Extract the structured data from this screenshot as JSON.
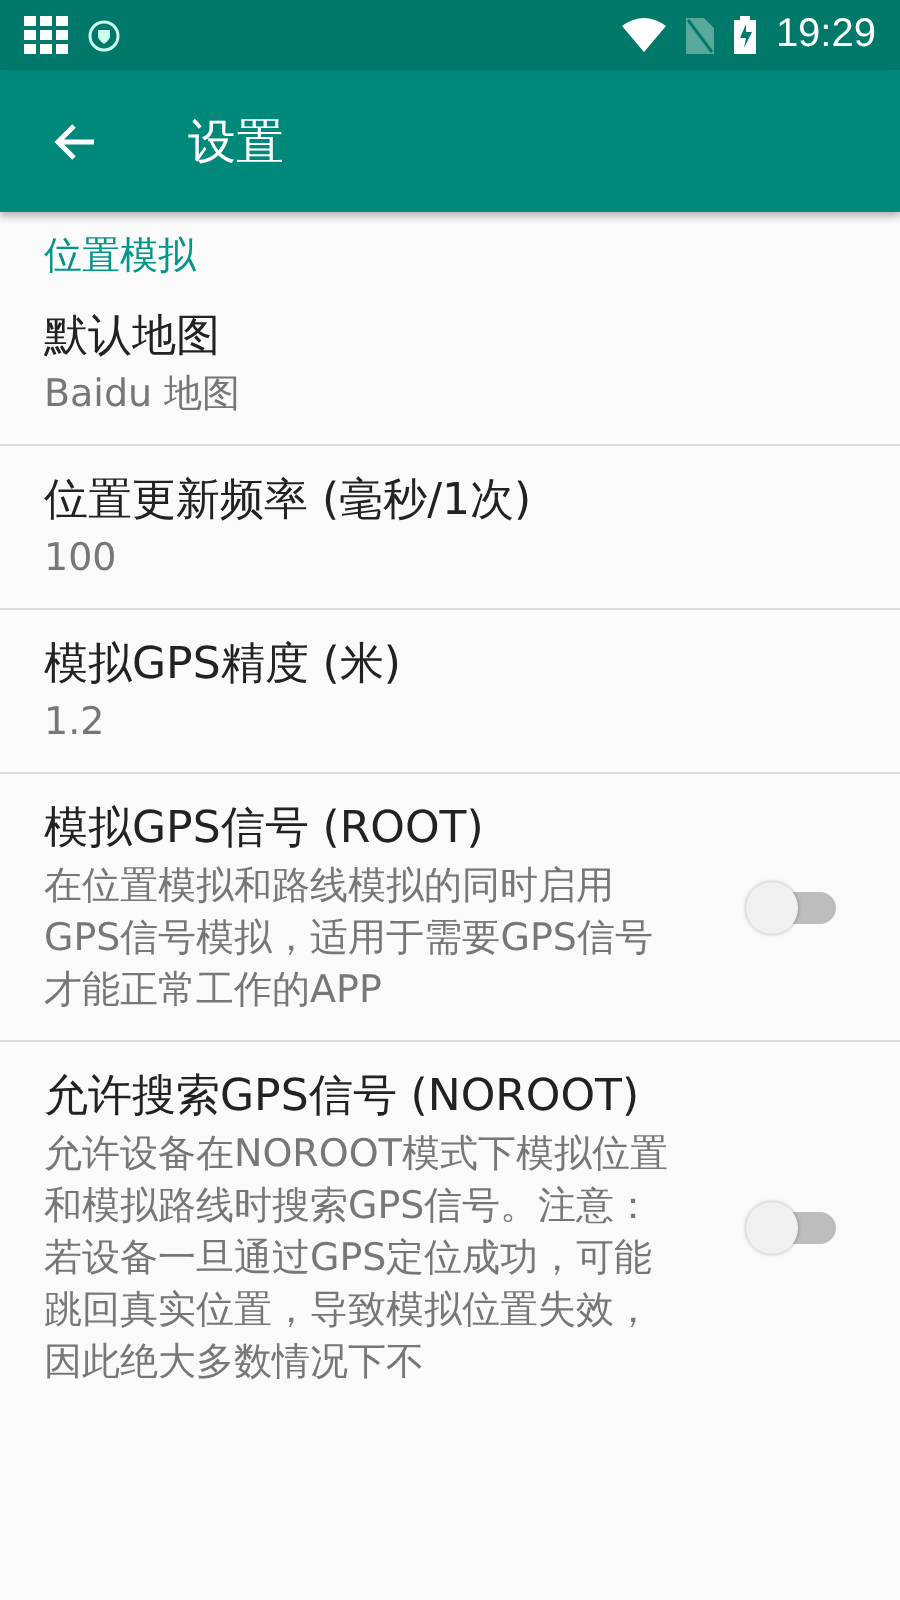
{
  "status_bar": {
    "time": "19:29"
  },
  "app_bar": {
    "title": "设置"
  },
  "category": {
    "title": "位置模拟"
  },
  "preferences": [
    {
      "kind": "text",
      "title": "默认地图",
      "summary": "Baidu 地图"
    },
    {
      "kind": "text",
      "title": "位置更新频率 (毫秒/1次)",
      "summary": "100"
    },
    {
      "kind": "text",
      "title": "模拟GPS精度 (米)",
      "summary": "1.2"
    },
    {
      "kind": "switch",
      "title": "模拟GPS信号 (ROOT)",
      "summary": "在位置模拟和路线模拟的同时启用GPS信号模拟，适用于需要GPS信号才能正常工作的APP",
      "on": false
    },
    {
      "kind": "switch",
      "title": "允许搜索GPS信号 (NOROOT)",
      "summary": "允许设备在NOROOT模式下模拟位置和模拟路线时搜索GPS信号。注意：若设备一旦通过GPS定位成功，可能跳回真实位置，导致模拟位置失效，因此绝大多数情况下不",
      "on": false
    }
  ]
}
